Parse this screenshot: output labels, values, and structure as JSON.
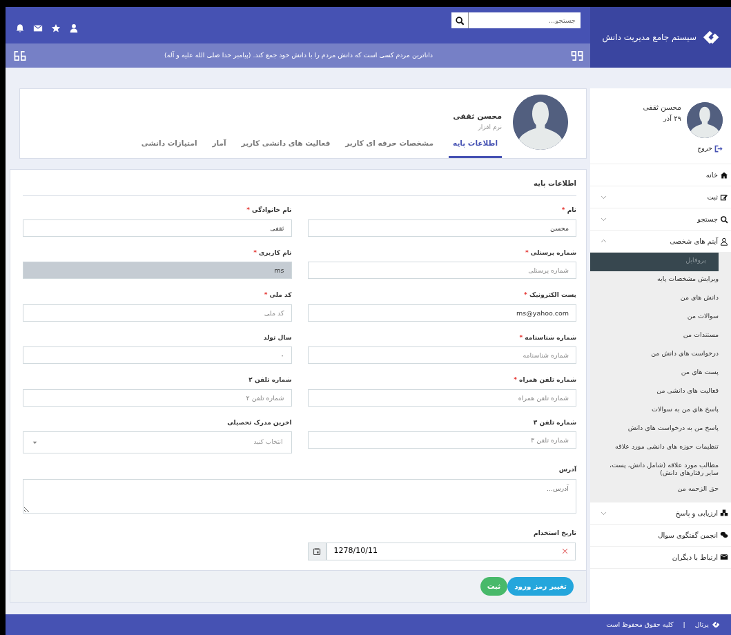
{
  "header": {
    "brand": "سیستم جامع مدیریت دانش",
    "search": {
      "placeholder": "جستجو..."
    },
    "quote": "داناترین مردم کسی است که دانش مردم را با دانش خود جمع کند. (پیامبر خدا صلی الله علیه و آله)"
  },
  "user_panel": {
    "name": "محسن ثقفی",
    "date": "۲۹ آذر",
    "logout": "خروج"
  },
  "sidebar": {
    "items": [
      {
        "label": "خانه"
      },
      {
        "label": "ثبت",
        "expanded": false
      },
      {
        "label": "جستجو",
        "expanded": false
      },
      {
        "label": "آیتم های شخصی",
        "expanded": true,
        "children": [
          {
            "label": "پروفایل",
            "selected": true
          },
          {
            "label": "ویرایش مشخصات پایه",
            "selected": false
          },
          {
            "label": "دانش های من",
            "selected": false
          },
          {
            "label": "سوالات من",
            "selected": false
          },
          {
            "label": "مستندات من",
            "selected": false
          },
          {
            "label": "درخواست های دانش من",
            "selected": false
          },
          {
            "label": "پست های من",
            "selected": false
          },
          {
            "label": "فعالیت های دانشی من",
            "selected": false
          },
          {
            "label": "پاسخ های من به سوالات",
            "selected": false
          },
          {
            "label": "پاسخ من به درخواست های دانش",
            "selected": false
          },
          {
            "label": "تنظیمات حوزه های دانشی مورد علاقه",
            "selected": false
          },
          {
            "label": "مطالب مورد علاقه (شامل دانش، پست، سایر رفتارهای دانش)",
            "selected": false
          },
          {
            "label": "حق الزحمه من",
            "selected": false
          }
        ]
      },
      {
        "label": "ارزیابی و پاسخ",
        "expanded": false
      },
      {
        "label": "انجمن گفتگوی سوال"
      },
      {
        "label": "ارتباط با دیگران"
      }
    ]
  },
  "profile": {
    "name": "محسن ثقفی",
    "role": "نرم افزار",
    "tabs": [
      {
        "label": "اطلاعات پایه",
        "selected": true
      },
      {
        "label": "مشخصات حرفه ای کاربر",
        "selected": false
      },
      {
        "label": "فعالیت های دانشی کاربر",
        "selected": false
      },
      {
        "label": "آمار",
        "selected": false
      },
      {
        "label": "امتیازات دانشی",
        "selected": false
      }
    ]
  },
  "form": {
    "title": "اطلاعات پایه",
    "fields": [
      {
        "kind": "text",
        "label": "نام",
        "required_mark": "*",
        "value": "محسن"
      },
      {
        "kind": "text",
        "label": "نام خانوادگی",
        "required_mark": "*",
        "value": "ثقفی"
      },
      {
        "kind": "text",
        "label": "شماره پرسنلی",
        "required_mark": "*",
        "placeholder": "شماره پرسنلی"
      },
      {
        "kind": "text",
        "label": "نام کاربری",
        "required_mark": "*",
        "value": "ms",
        "disabled": true
      },
      {
        "kind": "text",
        "label": "پست الکترونیک",
        "required_mark": "*",
        "value": "ms@yahoo.com"
      },
      {
        "kind": "text",
        "label": "کد ملی",
        "required_mark": "*",
        "placeholder": "کد ملی"
      },
      {
        "kind": "text",
        "label": "شماره شناسنامه",
        "required_mark": "*",
        "placeholder": "شماره شناسنامه"
      },
      {
        "kind": "text",
        "label": "سال تولد",
        "value": "۰"
      },
      {
        "kind": "text",
        "label": "شماره تلفن همراه",
        "required_mark": "*",
        "placeholder": "شماره تلفن همراه"
      },
      {
        "kind": "text",
        "label": "شماره تلفن ۲",
        "placeholder": "شماره تلفن ۲"
      },
      {
        "kind": "text",
        "label": "شماره تلفن ۳",
        "placeholder": "شماره تلفن ۳"
      },
      {
        "kind": "select",
        "label": "اخرین مدرک تحصیلی",
        "placeholder": "انتخاب کنید"
      },
      {
        "kind": "textarea",
        "label": "آدرس",
        "placeholder": "آدرس..."
      },
      {
        "kind": "date",
        "label": "تاریخ استخدام",
        "value": "1278/10/11"
      }
    ],
    "buttons": [
      {
        "label": "تغییر رمز ورود",
        "kind": "info"
      },
      {
        "label": "ثبت",
        "kind": "success"
      }
    ]
  },
  "footer": {
    "portal": "پرتال",
    "separator": "|",
    "copyright": "کلیه حقوق محفوظ است"
  }
}
